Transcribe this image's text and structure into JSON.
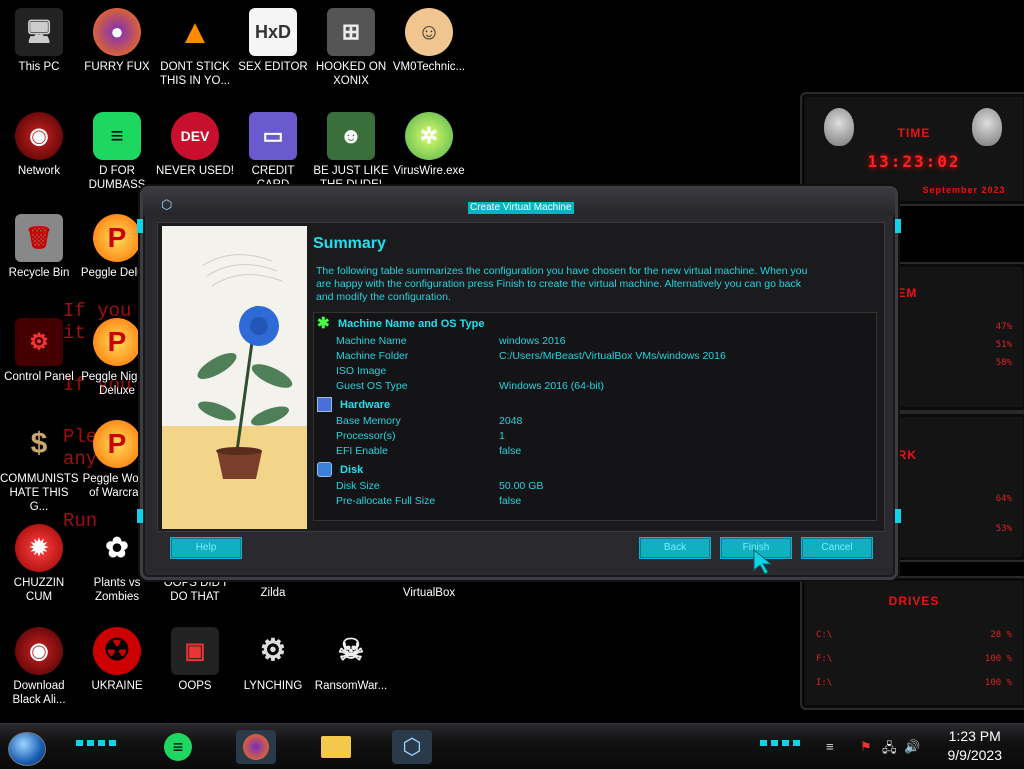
{
  "desktop": {
    "icons": [
      {
        "label": "This PC",
        "glyph": "pc-icon"
      },
      {
        "label": "FURRY FUX",
        "glyph": "firefox-icon"
      },
      {
        "label": "DONT STICK THIS IN YO...",
        "glyph": "vlc-icon"
      },
      {
        "label": "SEX EDITOR",
        "glyph": "hxd-icon"
      },
      {
        "label": "HOOKED ON XONIX",
        "glyph": "xonix-icon"
      },
      {
        "label": "VM0Technic...",
        "glyph": "doctor-icon"
      },
      {
        "label": "Network",
        "glyph": "network-icon"
      },
      {
        "label": "D FOR DUMBASS",
        "glyph": "spotify-icon"
      },
      {
        "label": "NEVER USED!",
        "glyph": "devcpp-icon"
      },
      {
        "label": "CREDIT CARD CHECKER",
        "glyph": "card-icon"
      },
      {
        "label": "BE JUST LIKE THE DUDE!",
        "glyph": "elf-icon"
      },
      {
        "label": "VirusWire.exe",
        "glyph": "lime-icon"
      },
      {
        "label": "Recycle Bin",
        "glyph": "recycle-bin-icon"
      },
      {
        "label": "Peggle Delu...",
        "glyph": "peggle-icon"
      },
      {
        "label": "Control Panel",
        "glyph": "control-panel-icon"
      },
      {
        "label": "Peggle Nights Deluxe",
        "glyph": "peggle-icon"
      },
      {
        "label": "COMMUNISTS HATE THIS G...",
        "glyph": "money-bag-icon"
      },
      {
        "label": "Peggle World of Warcraft",
        "glyph": "peggle-icon"
      },
      {
        "label": "CHUZZIN CUM",
        "glyph": "chuzzle-icon"
      },
      {
        "label": "Plants vs Zombies",
        "glyph": "pvz-icon"
      },
      {
        "label": "OOPS DID I DO THAT",
        "glyph": "oops-icon"
      },
      {
        "label": "Zilda",
        "glyph": "zelda-icon"
      },
      {
        "label": "VirtualBox",
        "glyph": "virtualbox-icon"
      },
      {
        "label": "Download Black Ali...",
        "glyph": "alien-icon"
      },
      {
        "label": "UKRAINE",
        "glyph": "radiation-icon"
      },
      {
        "label": "OOPS",
        "glyph": "oops-icon"
      },
      {
        "label": "LYNCHING",
        "glyph": "lynching-icon"
      },
      {
        "label": "RansomWar...",
        "glyph": "skull-icon"
      }
    ],
    "background_text": [
      "If you",
      "it",
      "If you",
      "Please",
      "any f",
      "Run"
    ]
  },
  "widget": {
    "time_title": "TIME",
    "clock": "13:23:02",
    "date": "September 2023",
    "system_title": "SYSTEM",
    "system_values": [
      "47%",
      "51%",
      "58%"
    ],
    "network_title": "NETWORK",
    "network_values": [
      "64%",
      "53%"
    ],
    "drives_title": "DRIVES",
    "drives": [
      {
        "name": "C:\\",
        "value": "28 %"
      },
      {
        "name": "F:\\",
        "value": "100 %"
      },
      {
        "name": "I:\\",
        "value": "100 %"
      }
    ]
  },
  "dialog": {
    "title": "Create Virtual Machine",
    "heading": "Summary",
    "description": "The following table summarizes the configuration you have chosen for the new virtual machine. When you are happy with the configuration press Finish to create the virtual machine. Alternatively you can go back and modify the configuration.",
    "sections": [
      {
        "title": "Machine Name and OS Type",
        "rows": [
          {
            "key": "Machine Name",
            "value": "windows 2016"
          },
          {
            "key": "Machine Folder",
            "value": "C:/Users/MrBeast/VirtualBox VMs/windows 2016"
          },
          {
            "key": "ISO Image",
            "value": ""
          },
          {
            "key": "Guest OS Type",
            "value": "Windows 2016 (64-bit)"
          }
        ]
      },
      {
        "title": "Hardware",
        "rows": [
          {
            "key": "Base Memory",
            "value": "2048"
          },
          {
            "key": "Processor(s)",
            "value": "1"
          },
          {
            "key": "EFI Enable",
            "value": "false"
          }
        ]
      },
      {
        "title": "Disk",
        "rows": [
          {
            "key": "Disk Size",
            "value": "50.00 GB"
          },
          {
            "key": "Pre-allocate Full Size",
            "value": "false"
          }
        ]
      }
    ],
    "buttons": {
      "help": "Help",
      "back": "Back",
      "finish": "Finish",
      "cancel": "Cancel"
    }
  },
  "taskbar": {
    "time": "1:23 PM",
    "date": "9/9/2023"
  }
}
